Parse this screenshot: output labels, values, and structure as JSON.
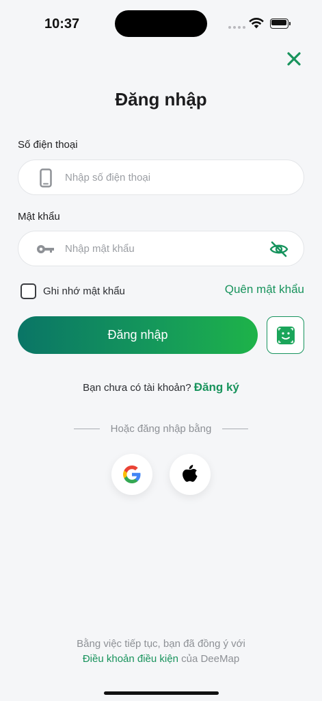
{
  "status_bar": {
    "time": "10:37"
  },
  "title": "Đăng nhập",
  "phone": {
    "label": "Số điện thoại",
    "placeholder": "Nhập số điện thoại",
    "value": ""
  },
  "password": {
    "label": "Mật khẩu",
    "placeholder": "Nhập mật khẩu",
    "value": ""
  },
  "remember_label": "Ghi nhớ mật khẩu",
  "forgot_label": "Quên mật khẩu",
  "login_button_label": "Đăng nhập",
  "signup": {
    "prompt": "Bạn chưa có tài khoản?",
    "link": "Đăng ký"
  },
  "divider_text": "Hoặc đăng nhập bằng",
  "terms": {
    "line1": "Bằng việc tiếp tục, bạn đã đồng ý với",
    "link": "Điều khoản điều kiện",
    "suffix": "của DeeMap"
  },
  "colors": {
    "accent": "#18935c",
    "gradient_start": "#0a7566",
    "gradient_end": "#1eb349",
    "background": "#f5f6f8"
  },
  "icons": [
    "close-icon",
    "phone-icon",
    "key-icon",
    "eye-off-icon",
    "face-id-icon",
    "google-icon",
    "apple-icon"
  ]
}
